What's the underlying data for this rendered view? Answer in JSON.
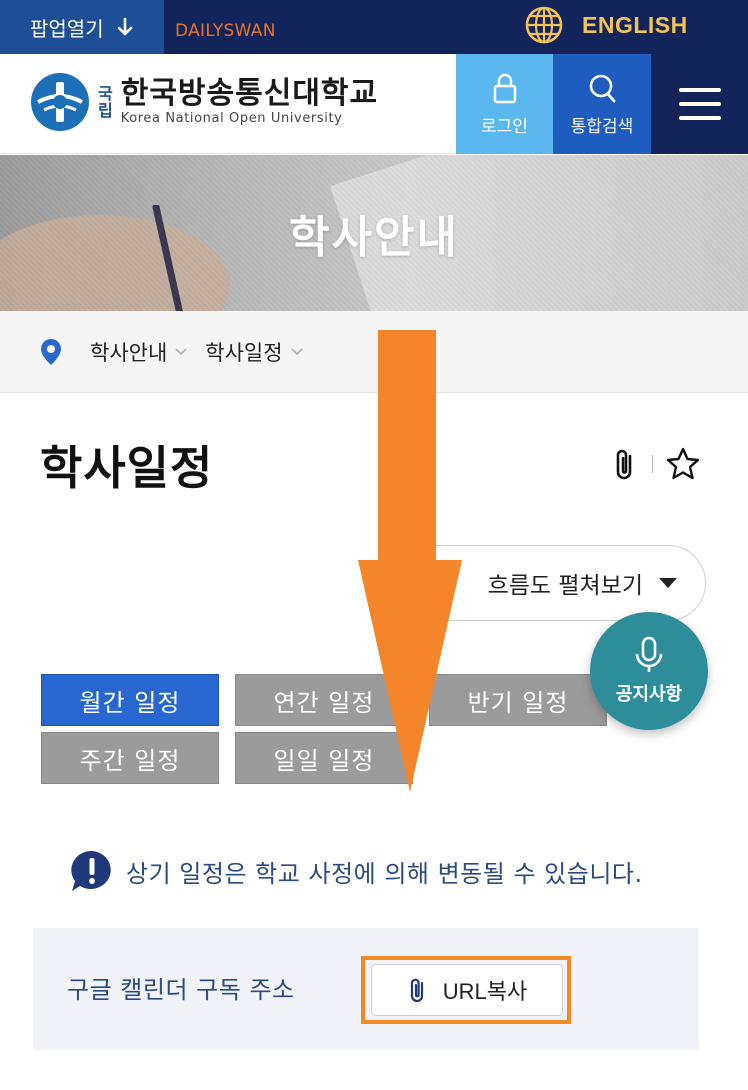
{
  "topbar": {
    "popup_label": "팝업열기",
    "brand_label": "DAILYSWAN",
    "language_label": "ENGLISH",
    "icons": [
      "arrow-down-icon",
      "globe-icon"
    ]
  },
  "header": {
    "logo_sub_1": "국",
    "logo_sub_2": "립",
    "logo_ko": "한국방송통신대학교",
    "logo_en": "Korea National Open University",
    "login_label": "로그인",
    "search_label": "통합검색",
    "icons": [
      "lock-icon",
      "search-icon",
      "hamburger-menu-icon"
    ],
    "colors": {
      "login": "#5ab8ef",
      "search": "#1f5cc0",
      "menu": "#13245a"
    }
  },
  "banner": {
    "title": "학사안내"
  },
  "breadcrumb": {
    "items": [
      {
        "label": "학사안내"
      },
      {
        "label": "학사일정"
      }
    ]
  },
  "page": {
    "title": "학사일정",
    "flow_toggle_label": "흐름도 펼쳐보기",
    "fab_label": "공지사항"
  },
  "tabs": [
    {
      "label": "월간 일정",
      "active": true
    },
    {
      "label": "연간 일정",
      "active": false
    },
    {
      "label": "반기 일정",
      "active": false
    },
    {
      "label": "주간 일정",
      "active": false
    },
    {
      "label": "일일 일정",
      "active": false
    }
  ],
  "notice": {
    "text": "상기 일정은 학교 사정에 의해 변동될 수 있습니다."
  },
  "gcal": {
    "label": "구글 캘린더 구독 주소",
    "button_label": "URL복사"
  },
  "accent_colors": {
    "highlight": "#f08a24",
    "primary": "#2767cf"
  }
}
